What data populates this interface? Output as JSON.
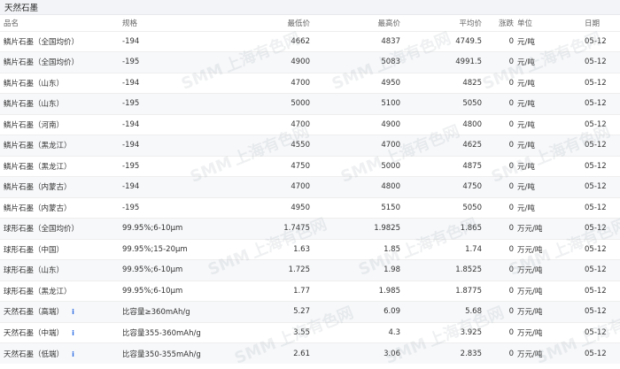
{
  "page": {
    "title": "天然石墨"
  },
  "columns": [
    "品名",
    "规格",
    "最低价",
    "最高价",
    "平均价",
    "涨跌",
    "单位",
    "日期"
  ],
  "rows": [
    {
      "name": "鳞片石墨（全国均价）",
      "spec": "-194",
      "low": "4662",
      "high": "4837",
      "avg": "4749.5",
      "change": "0",
      "unit": "元/吨",
      "date": "05-12"
    },
    {
      "name": "鳞片石墨（全国均价）",
      "spec": "-195",
      "low": "4900",
      "high": "5083",
      "avg": "4991.5",
      "change": "0",
      "unit": "元/吨",
      "date": "05-12"
    },
    {
      "name": "鳞片石墨（山东）",
      "spec": "-194",
      "low": "4700",
      "high": "4950",
      "avg": "4825",
      "change": "0",
      "unit": "元/吨",
      "date": "05-12"
    },
    {
      "name": "鳞片石墨（山东）",
      "spec": "-195",
      "low": "5000",
      "high": "5100",
      "avg": "5050",
      "change": "0",
      "unit": "元/吨",
      "date": "05-12"
    },
    {
      "name": "鳞片石墨（河南）",
      "spec": "-194",
      "low": "4700",
      "high": "4900",
      "avg": "4800",
      "change": "0",
      "unit": "元/吨",
      "date": "05-12"
    },
    {
      "name": "鳞片石墨（黑龙江）",
      "spec": "-194",
      "low": "4550",
      "high": "4700",
      "avg": "4625",
      "change": "0",
      "unit": "元/吨",
      "date": "05-12"
    },
    {
      "name": "鳞片石墨（黑龙江）",
      "spec": "-195",
      "low": "4750",
      "high": "5000",
      "avg": "4875",
      "change": "0",
      "unit": "元/吨",
      "date": "05-12"
    },
    {
      "name": "鳞片石墨（内蒙古）",
      "spec": "-194",
      "low": "4700",
      "high": "4800",
      "avg": "4750",
      "change": "0",
      "unit": "元/吨",
      "date": "05-12"
    },
    {
      "name": "鳞片石墨（内蒙古）",
      "spec": "-195",
      "low": "4950",
      "high": "5150",
      "avg": "5050",
      "change": "0",
      "unit": "元/吨",
      "date": "05-12"
    },
    {
      "name": "球形石墨（全国均价）",
      "spec": "99.95%;6-10μm",
      "low": "1.7475",
      "high": "1.9825",
      "avg": "1.865",
      "change": "0",
      "unit": "万元/吨",
      "date": "05-12"
    },
    {
      "name": "球形石墨（中国）",
      "spec": "99.95%;15-20μm",
      "low": "1.63",
      "high": "1.85",
      "avg": "1.74",
      "change": "0",
      "unit": "万元/吨",
      "date": "05-12"
    },
    {
      "name": "球形石墨（山东）",
      "spec": "99.95%;6-10μm",
      "low": "1.725",
      "high": "1.98",
      "avg": "1.8525",
      "change": "0",
      "unit": "万元/吨",
      "date": "05-12"
    },
    {
      "name": "球形石墨（黑龙江）",
      "spec": "99.95%;6-10μm",
      "low": "1.77",
      "high": "1.985",
      "avg": "1.8775",
      "change": "0",
      "unit": "万元/吨",
      "date": "05-12"
    },
    {
      "name": "天然石墨（高端）",
      "info": "i",
      "spec": "比容量≥360mAh/g",
      "low": "5.27",
      "high": "6.09",
      "avg": "5.68",
      "change": "0",
      "unit": "万元/吨",
      "date": "05-12"
    },
    {
      "name": "天然石墨（中端）",
      "info": "i",
      "spec": "比容量355-360mAh/g",
      "low": "3.55",
      "high": "4.3",
      "avg": "3.925",
      "change": "0",
      "unit": "万元/吨",
      "date": "05-12"
    },
    {
      "name": "天然石墨（低端）",
      "info": "i",
      "spec": "比容量350-355mAh/g",
      "low": "2.61",
      "high": "3.06",
      "avg": "2.835",
      "change": "0",
      "unit": "万元/吨",
      "date": "05-12"
    }
  ],
  "watermark": {
    "brand": "SMM",
    "text": "上海有色网"
  }
}
